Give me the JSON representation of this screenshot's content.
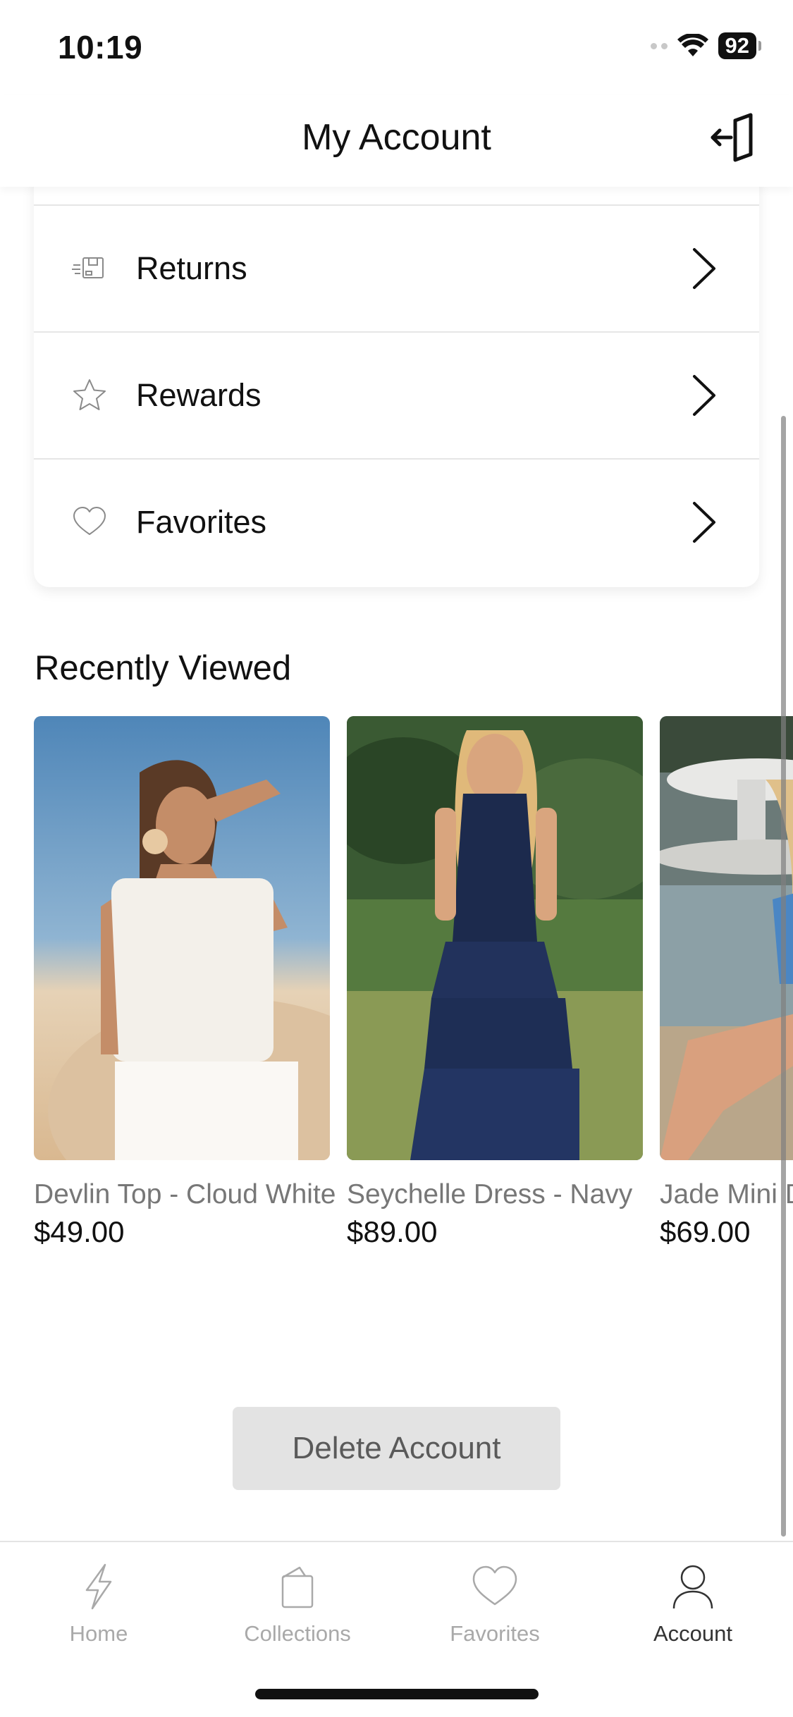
{
  "status_bar": {
    "time": "10:19",
    "battery": "92"
  },
  "header": {
    "title": "My Account",
    "logout_icon": "logout-icon"
  },
  "menu": {
    "items": [
      {
        "label": "Returns",
        "icon": "returns-box-icon"
      },
      {
        "label": "Rewards",
        "icon": "star-icon"
      },
      {
        "label": "Favorites",
        "icon": "heart-icon"
      }
    ]
  },
  "recently_viewed": {
    "title": "Recently Viewed",
    "products": [
      {
        "name": "Devlin Top - Cloud White",
        "price": "$49.00"
      },
      {
        "name": "Seychelle Dress - Navy",
        "price": "$89.00"
      },
      {
        "name": "Jade Mini Dress",
        "price": "$69.00"
      }
    ]
  },
  "actions": {
    "delete_account": "Delete Account"
  },
  "tab_bar": {
    "tabs": [
      {
        "label": "Home",
        "icon": "lightning-icon",
        "active": false
      },
      {
        "label": "Collections",
        "icon": "collections-icon",
        "active": false
      },
      {
        "label": "Favorites",
        "icon": "heart-icon",
        "active": false
      },
      {
        "label": "Account",
        "icon": "person-icon",
        "active": true
      }
    ]
  },
  "colors": {
    "text": "#111111",
    "muted": "#777777",
    "tab_inactive": "#a9a9a9",
    "button_bg": "#e3e3e3"
  }
}
